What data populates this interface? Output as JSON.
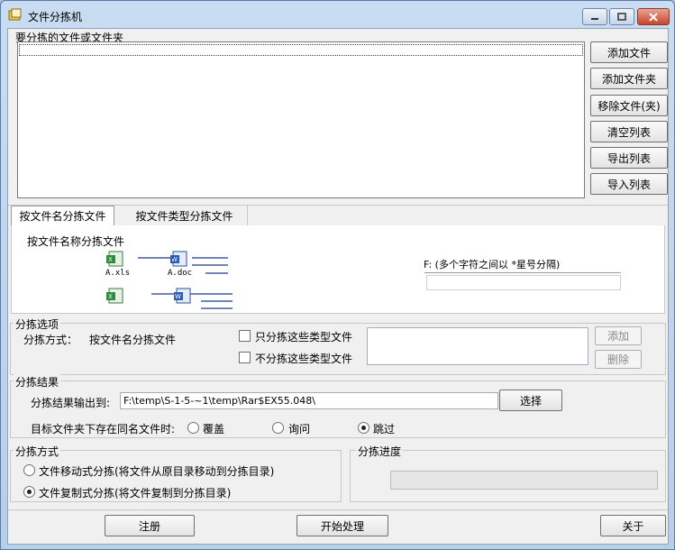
{
  "window": {
    "title": "文件分拣机"
  },
  "files": {
    "group_label": "要分拣的文件或文件夹",
    "buttons": {
      "add_file": "添加文件",
      "add_folder": "添加文件夹",
      "remove": "移除文件(夹)",
      "clear": "清空列表",
      "export": "导出列表",
      "import": "导入列表"
    }
  },
  "tabs": {
    "by_name": "按文件名分拣文件",
    "by_type": "按文件类型分拣文件"
  },
  "tab_panel": {
    "heading": "按文件名称分拣文件",
    "icon_labels": [
      "A.xls",
      "A.doc"
    ],
    "hint": "F: (多个字符之间以 *星号分隔)"
  },
  "options": {
    "group_label": "分拣选项",
    "mode_label": "分拣方式：",
    "mode_value": "按文件名分拣文件",
    "only_types": "只分拣这些类型文件",
    "exclude_types": "不分拣这些类型文件",
    "add_button": "添加",
    "delete_button": "删除"
  },
  "result": {
    "group_label": "分拣结果",
    "output_label": "分拣结果输出到:",
    "output_path": "F:\\temp\\S-1-5-~1\\temp\\Rar$EX55.048\\",
    "choose_button": "选择",
    "conflict_label": "目标文件夹下存在同名文件时:",
    "conflict_options": [
      "覆盖",
      "询问",
      "跳过"
    ],
    "conflict_selected": "跳过"
  },
  "method": {
    "group_label": "分拣方式",
    "move": "文件移动式分拣(将文件从原目录移动到分拣目录)",
    "copy": "文件复制式分拣(将文件复制到分拣目录)",
    "selected": "copy"
  },
  "progress": {
    "group_label": "分拣进度",
    "value": 0
  },
  "footer": {
    "register": "注册",
    "start": "开始处理",
    "about": "关于"
  }
}
